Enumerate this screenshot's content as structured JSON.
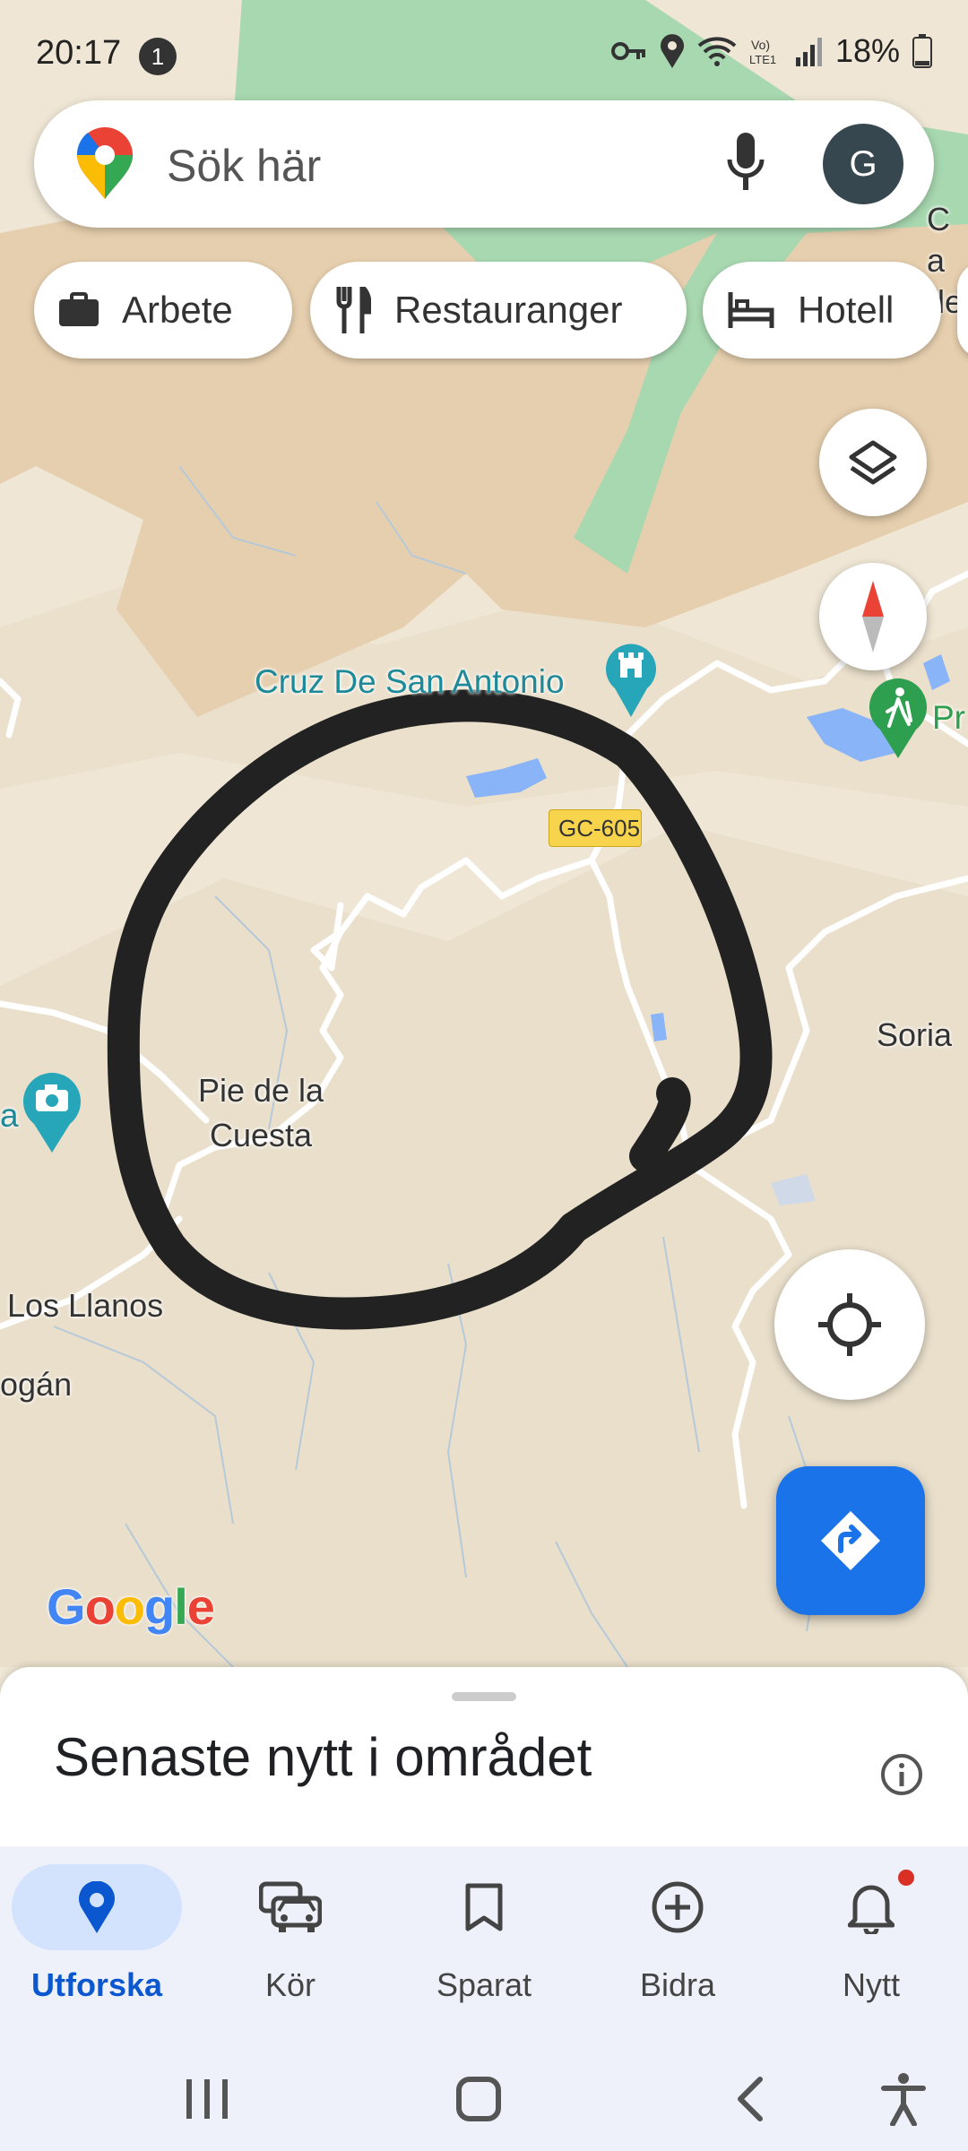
{
  "status_bar": {
    "time": "20:17",
    "notification_count": "1",
    "battery": "18%"
  },
  "search": {
    "placeholder": "Sök här",
    "avatar_letter": "G"
  },
  "chips": [
    {
      "label": "Arbete",
      "icon": "briefcase-icon"
    },
    {
      "label": "Restauranger",
      "icon": "fork-knife-icon"
    },
    {
      "label": "Hotell",
      "icon": "bed-icon"
    }
  ],
  "map": {
    "labels": {
      "poi_castle": "Cruz De San Antonio",
      "road": "GC-605",
      "village": "Pie de la Cuesta",
      "soria": "Soria",
      "los_llanos": "Los Llanos",
      "ogan": "ogán",
      "ca_de": "Ca de",
      "pr": "Pr",
      "a": "a"
    },
    "logo": "Google",
    "colors": {
      "terrain": "#efe6d5",
      "brown_area": "#e8d2b4",
      "green_area": "#a8d8b0",
      "water": "#8ab4f8",
      "circle_stroke": "#222222"
    }
  },
  "sheet": {
    "title": "Senaste nytt i området"
  },
  "nav": [
    {
      "label": "Utforska",
      "icon": "location-pin-icon",
      "active": true
    },
    {
      "label": "Kör",
      "icon": "car-icon",
      "active": false
    },
    {
      "label": "Sparat",
      "icon": "bookmark-icon",
      "active": false
    },
    {
      "label": "Bidra",
      "icon": "add-circle-icon",
      "active": false
    },
    {
      "label": "Nytt",
      "icon": "bell-icon",
      "active": false
    }
  ],
  "accent": "#1a73e8"
}
